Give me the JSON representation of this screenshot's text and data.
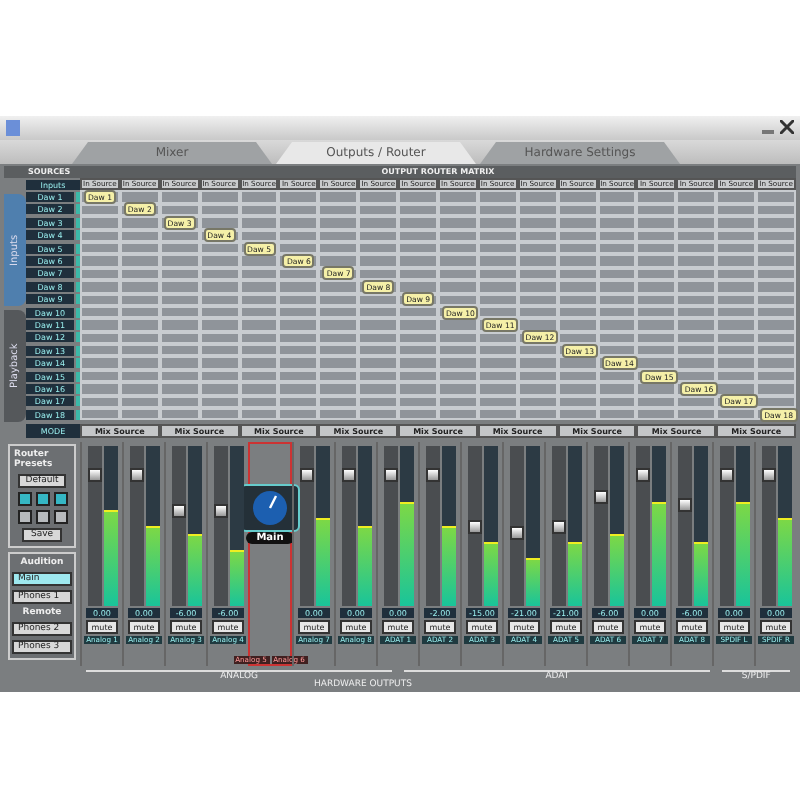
{
  "tabs": [
    {
      "label": "Mixer",
      "selected": false
    },
    {
      "label": "Outputs / Router",
      "selected": true
    },
    {
      "label": "Hardware Settings",
      "selected": false
    }
  ],
  "sources_header": "SOURCES",
  "matrix_title": "OUTPUT ROUTER MATRIX",
  "side_tabs": [
    {
      "label": "Inputs",
      "selected": true
    },
    {
      "label": "Playback",
      "selected": false
    }
  ],
  "source_header": "Inputs",
  "mode_label": "MODE",
  "matrix": {
    "columns": [
      "In Source",
      "In Source",
      "In Source",
      "In Source",
      "In Source",
      "In Source",
      "In Source",
      "In Source",
      "In Source",
      "In Source",
      "In Source",
      "In Source",
      "In Source",
      "In Source",
      "In Source",
      "In Source",
      "In Source",
      "In Source"
    ],
    "rows": [
      {
        "label": "Daw 1",
        "cells": [
          {
            "routed": true,
            "text": "Daw 1"
          },
          {
            "routed": false
          },
          {
            "routed": false
          },
          {
            "routed": false
          },
          {
            "routed": false
          },
          {
            "routed": false
          },
          {
            "routed": false
          },
          {
            "routed": false
          },
          {
            "routed": false
          },
          {
            "routed": false
          },
          {
            "routed": false
          },
          {
            "routed": false
          },
          {
            "routed": false
          },
          {
            "routed": false
          },
          {
            "routed": false
          },
          {
            "routed": false
          },
          {
            "routed": false
          },
          {
            "routed": false
          }
        ]
      },
      {
        "label": "Daw 2",
        "cells": [
          {
            "routed": false
          },
          {
            "routed": true,
            "text": "Daw 2"
          },
          {
            "routed": false
          },
          {
            "routed": false
          },
          {
            "routed": false
          },
          {
            "routed": false
          },
          {
            "routed": false
          },
          {
            "routed": false
          },
          {
            "routed": false
          },
          {
            "routed": false
          },
          {
            "routed": false
          },
          {
            "routed": false
          },
          {
            "routed": false
          },
          {
            "routed": false
          },
          {
            "routed": false
          },
          {
            "routed": false
          },
          {
            "routed": false
          },
          {
            "routed": false
          }
        ]
      },
      {
        "label": "Daw 3",
        "cells": [
          {
            "routed": false
          },
          {
            "routed": false
          },
          {
            "routed": true,
            "text": "Daw 3"
          },
          {
            "routed": false
          },
          {
            "routed": false
          },
          {
            "routed": false
          },
          {
            "routed": false
          },
          {
            "routed": false
          },
          {
            "routed": false
          },
          {
            "routed": false
          },
          {
            "routed": false
          },
          {
            "routed": false
          },
          {
            "routed": false
          },
          {
            "routed": false
          },
          {
            "routed": false
          },
          {
            "routed": false
          },
          {
            "routed": false
          },
          {
            "routed": false
          }
        ]
      },
      {
        "label": "Daw 4",
        "cells": [
          {
            "routed": false
          },
          {
            "routed": false
          },
          {
            "routed": false
          },
          {
            "routed": true,
            "text": "Daw 4"
          },
          {
            "routed": false
          },
          {
            "routed": false
          },
          {
            "routed": false
          },
          {
            "routed": false
          },
          {
            "routed": false
          },
          {
            "routed": false
          },
          {
            "routed": false
          },
          {
            "routed": false
          },
          {
            "routed": false
          },
          {
            "routed": false
          },
          {
            "routed": false
          },
          {
            "routed": false
          },
          {
            "routed": false
          },
          {
            "routed": false
          }
        ]
      },
      {
        "label": "Daw 5",
        "cells": [
          {
            "routed": false
          },
          {
            "routed": false
          },
          {
            "routed": false
          },
          {
            "routed": false
          },
          {
            "routed": true,
            "text": "Daw 5"
          },
          {
            "routed": false
          },
          {
            "routed": false
          },
          {
            "routed": false
          },
          {
            "routed": false
          },
          {
            "routed": false
          },
          {
            "routed": false
          },
          {
            "routed": false
          },
          {
            "routed": false
          },
          {
            "routed": false
          },
          {
            "routed": false
          },
          {
            "routed": false
          },
          {
            "routed": false
          },
          {
            "routed": false
          }
        ]
      },
      {
        "label": "Daw 6",
        "cells": [
          {
            "routed": false
          },
          {
            "routed": false
          },
          {
            "routed": false
          },
          {
            "routed": false
          },
          {
            "routed": false
          },
          {
            "routed": true,
            "text": "Daw 6"
          },
          {
            "routed": false
          },
          {
            "routed": false
          },
          {
            "routed": false
          },
          {
            "routed": false
          },
          {
            "routed": false
          },
          {
            "routed": false
          },
          {
            "routed": false
          },
          {
            "routed": false
          },
          {
            "routed": false
          },
          {
            "routed": false
          },
          {
            "routed": false
          },
          {
            "routed": false
          }
        ]
      },
      {
        "label": "Daw 7",
        "cells": [
          {
            "routed": false
          },
          {
            "routed": false
          },
          {
            "routed": false
          },
          {
            "routed": false
          },
          {
            "routed": false
          },
          {
            "routed": false
          },
          {
            "routed": true,
            "text": "Daw 7"
          },
          {
            "routed": false
          },
          {
            "routed": false
          },
          {
            "routed": false
          },
          {
            "routed": false
          },
          {
            "routed": false
          },
          {
            "routed": false
          },
          {
            "routed": false
          },
          {
            "routed": false
          },
          {
            "routed": false
          },
          {
            "routed": false
          },
          {
            "routed": false
          }
        ]
      },
      {
        "label": "Daw 8",
        "cells": [
          {
            "routed": false
          },
          {
            "routed": false
          },
          {
            "routed": false
          },
          {
            "routed": false
          },
          {
            "routed": false
          },
          {
            "routed": false
          },
          {
            "routed": false
          },
          {
            "routed": true,
            "text": "Daw 8"
          },
          {
            "routed": false
          },
          {
            "routed": false
          },
          {
            "routed": false
          },
          {
            "routed": false
          },
          {
            "routed": false
          },
          {
            "routed": false
          },
          {
            "routed": false
          },
          {
            "routed": false
          },
          {
            "routed": false
          },
          {
            "routed": false
          }
        ]
      },
      {
        "label": "Daw 9",
        "cells": [
          {
            "routed": false
          },
          {
            "routed": false
          },
          {
            "routed": false
          },
          {
            "routed": false
          },
          {
            "routed": false
          },
          {
            "routed": false
          },
          {
            "routed": false
          },
          {
            "routed": false
          },
          {
            "routed": true,
            "text": "Daw 9"
          },
          {
            "routed": false
          },
          {
            "routed": false
          },
          {
            "routed": false
          },
          {
            "routed": false
          },
          {
            "routed": false
          },
          {
            "routed": false
          },
          {
            "routed": false
          },
          {
            "routed": false
          },
          {
            "routed": false
          }
        ]
      },
      {
        "label": "Daw 10",
        "cells": [
          {
            "routed": false
          },
          {
            "routed": false
          },
          {
            "routed": false
          },
          {
            "routed": false
          },
          {
            "routed": false
          },
          {
            "routed": false
          },
          {
            "routed": false
          },
          {
            "routed": false
          },
          {
            "routed": false
          },
          {
            "routed": true,
            "text": "Daw 10"
          },
          {
            "routed": false
          },
          {
            "routed": false
          },
          {
            "routed": false
          },
          {
            "routed": false
          },
          {
            "routed": false
          },
          {
            "routed": false
          },
          {
            "routed": false
          },
          {
            "routed": false
          }
        ]
      },
      {
        "label": "Daw 11",
        "cells": [
          {
            "routed": false
          },
          {
            "routed": false
          },
          {
            "routed": false
          },
          {
            "routed": false
          },
          {
            "routed": false
          },
          {
            "routed": false
          },
          {
            "routed": false
          },
          {
            "routed": false
          },
          {
            "routed": false
          },
          {
            "routed": false
          },
          {
            "routed": true,
            "text": "Daw 11"
          },
          {
            "routed": false
          },
          {
            "routed": false
          },
          {
            "routed": false
          },
          {
            "routed": false
          },
          {
            "routed": false
          },
          {
            "routed": false
          },
          {
            "routed": false
          }
        ]
      },
      {
        "label": "Daw 12",
        "cells": [
          {
            "routed": false
          },
          {
            "routed": false
          },
          {
            "routed": false
          },
          {
            "routed": false
          },
          {
            "routed": false
          },
          {
            "routed": false
          },
          {
            "routed": false
          },
          {
            "routed": false
          },
          {
            "routed": false
          },
          {
            "routed": false
          },
          {
            "routed": false
          },
          {
            "routed": true,
            "text": "Daw 12"
          },
          {
            "routed": false
          },
          {
            "routed": false
          },
          {
            "routed": false
          },
          {
            "routed": false
          },
          {
            "routed": false
          },
          {
            "routed": false
          }
        ]
      },
      {
        "label": "Daw 13",
        "cells": [
          {
            "routed": false
          },
          {
            "routed": false
          },
          {
            "routed": false
          },
          {
            "routed": false
          },
          {
            "routed": false
          },
          {
            "routed": false
          },
          {
            "routed": false
          },
          {
            "routed": false
          },
          {
            "routed": false
          },
          {
            "routed": false
          },
          {
            "routed": false
          },
          {
            "routed": false
          },
          {
            "routed": true,
            "text": "Daw 13"
          },
          {
            "routed": false
          },
          {
            "routed": false
          },
          {
            "routed": false
          },
          {
            "routed": false
          },
          {
            "routed": false
          }
        ]
      },
      {
        "label": "Daw 14",
        "cells": [
          {
            "routed": false
          },
          {
            "routed": false
          },
          {
            "routed": false
          },
          {
            "routed": false
          },
          {
            "routed": false
          },
          {
            "routed": false
          },
          {
            "routed": false
          },
          {
            "routed": false
          },
          {
            "routed": false
          },
          {
            "routed": false
          },
          {
            "routed": false
          },
          {
            "routed": false
          },
          {
            "routed": false
          },
          {
            "routed": true,
            "text": "Daw 14"
          },
          {
            "routed": false
          },
          {
            "routed": false
          },
          {
            "routed": false
          },
          {
            "routed": false
          }
        ]
      },
      {
        "label": "Daw 15",
        "cells": [
          {
            "routed": false
          },
          {
            "routed": false
          },
          {
            "routed": false
          },
          {
            "routed": false
          },
          {
            "routed": false
          },
          {
            "routed": false
          },
          {
            "routed": false
          },
          {
            "routed": false
          },
          {
            "routed": false
          },
          {
            "routed": false
          },
          {
            "routed": false
          },
          {
            "routed": false
          },
          {
            "routed": false
          },
          {
            "routed": false
          },
          {
            "routed": true,
            "text": "Daw 15"
          },
          {
            "routed": false
          },
          {
            "routed": false
          },
          {
            "routed": false
          }
        ]
      },
      {
        "label": "Daw 16",
        "cells": [
          {
            "routed": false
          },
          {
            "routed": false
          },
          {
            "routed": false
          },
          {
            "routed": false
          },
          {
            "routed": false
          },
          {
            "routed": false
          },
          {
            "routed": false
          },
          {
            "routed": false
          },
          {
            "routed": false
          },
          {
            "routed": false
          },
          {
            "routed": false
          },
          {
            "routed": false
          },
          {
            "routed": false
          },
          {
            "routed": false
          },
          {
            "routed": false
          },
          {
            "routed": true,
            "text": "Daw 16"
          },
          {
            "routed": false
          },
          {
            "routed": false
          }
        ]
      },
      {
        "label": "Daw 17",
        "cells": [
          {
            "routed": false
          },
          {
            "routed": false
          },
          {
            "routed": false
          },
          {
            "routed": false
          },
          {
            "routed": false
          },
          {
            "routed": false
          },
          {
            "routed": false
          },
          {
            "routed": false
          },
          {
            "routed": false
          },
          {
            "routed": false
          },
          {
            "routed": false
          },
          {
            "routed": false
          },
          {
            "routed": false
          },
          {
            "routed": false
          },
          {
            "routed": false
          },
          {
            "routed": false
          },
          {
            "routed": true,
            "text": "Daw 17"
          },
          {
            "routed": false
          }
        ]
      },
      {
        "label": "Daw 18",
        "cells": [
          {
            "routed": false
          },
          {
            "routed": false
          },
          {
            "routed": false
          },
          {
            "routed": false
          },
          {
            "routed": false
          },
          {
            "routed": false
          },
          {
            "routed": false
          },
          {
            "routed": false
          },
          {
            "routed": false
          },
          {
            "routed": false
          },
          {
            "routed": false
          },
          {
            "routed": false
          },
          {
            "routed": false
          },
          {
            "routed": false
          },
          {
            "routed": false
          },
          {
            "routed": false
          },
          {
            "routed": false
          },
          {
            "routed": true,
            "text": "Daw 18"
          }
        ]
      }
    ],
    "mix_sources": [
      "Mix Source",
      "Mix Source",
      "Mix Source",
      "Mix Source",
      "Mix Source",
      "Mix Source",
      "Mix Source",
      "Mix Source",
      "Mix Source"
    ]
  },
  "presets": {
    "title": "Router Presets",
    "default": "Default",
    "slots": [
      {
        "lit": true
      },
      {
        "lit": true
      },
      {
        "lit": true
      },
      {
        "lit": false
      },
      {
        "lit": false
      },
      {
        "lit": false
      }
    ],
    "save": "Save"
  },
  "audition": {
    "title": "Audition",
    "main": "Main",
    "phones_1": "Phones 1",
    "remote_label": "Remote",
    "phones_2": "Phones 2",
    "phones_3": "Phones 3"
  },
  "strips": [
    {
      "kind": "fader",
      "name": "Analog 1",
      "fader": {
        "level": 0.85
      },
      "meter": {
        "level": 0.6
      },
      "readout": "0.00",
      "mute": "mute",
      "muted": false
    },
    {
      "kind": "fader",
      "name": "Analog 2",
      "fader": {
        "level": 0.85
      },
      "meter": {
        "level": 0.5
      },
      "readout": "0.00",
      "mute": "mute",
      "muted": false
    },
    {
      "kind": "fader",
      "name": "Analog 3",
      "fader": {
        "level": 0.6
      },
      "meter": {
        "level": 0.45
      },
      "readout": "-6.00",
      "mute": "mute",
      "muted": false
    },
    {
      "kind": "fader",
      "name": "Analog 4",
      "fader": {
        "level": 0.6
      },
      "meter": {
        "level": 0.35
      },
      "readout": "-6.00",
      "mute": "mute",
      "muted": false
    },
    {
      "kind": "monitor",
      "label": "Main",
      "names": [
        "Analog 5",
        "Analog 6"
      ]
    },
    {
      "kind": "fader",
      "name": "Analog 7",
      "fader": {
        "level": 0.85
      },
      "meter": {
        "level": 0.55
      },
      "readout": "0.00",
      "mute": "mute",
      "muted": false
    },
    {
      "kind": "fader",
      "name": "Analog 8",
      "fader": {
        "level": 0.85
      },
      "meter": {
        "level": 0.5
      },
      "readout": "0.00",
      "mute": "mute",
      "muted": false
    },
    {
      "kind": "fader",
      "name": "ADAT 1",
      "fader": {
        "level": 0.85
      },
      "meter": {
        "level": 0.65
      },
      "readout": "0.00",
      "mute": "mute",
      "muted": false
    },
    {
      "kind": "fader",
      "name": "ADAT 2",
      "fader": {
        "level": 0.85
      },
      "meter": {
        "level": 0.5
      },
      "readout": "-2.00",
      "mute": "mute",
      "muted": false
    },
    {
      "kind": "fader",
      "name": "ADAT 3",
      "fader": {
        "level": 0.5
      },
      "meter": {
        "level": 0.4
      },
      "readout": "-15.00",
      "mute": "mute",
      "muted": false
    },
    {
      "kind": "fader",
      "name": "ADAT 4",
      "fader": {
        "level": 0.45
      },
      "meter": {
        "level": 0.3
      },
      "readout": "-21.00",
      "mute": "mute",
      "muted": false
    },
    {
      "kind": "fader",
      "name": "ADAT 5",
      "fader": {
        "level": 0.5
      },
      "meter": {
        "level": 0.4
      },
      "readout": "-21.00",
      "mute": "mute",
      "muted": false
    },
    {
      "kind": "fader",
      "name": "ADAT 6",
      "fader": {
        "level": 0.7
      },
      "meter": {
        "level": 0.45
      },
      "readout": "-6.00",
      "mute": "mute",
      "muted": false
    },
    {
      "kind": "fader",
      "name": "ADAT 7",
      "fader": {
        "level": 0.85
      },
      "meter": {
        "level": 0.65
      },
      "readout": "0.00",
      "mute": "mute",
      "muted": false
    },
    {
      "kind": "fader",
      "name": "ADAT 8",
      "fader": {
        "level": 0.65
      },
      "meter": {
        "level": 0.4
      },
      "readout": "-6.00",
      "mute": "mute",
      "muted": false
    },
    {
      "kind": "fader",
      "name": "SPDIF L",
      "fader": {
        "level": 0.85
      },
      "meter": {
        "level": 0.65
      },
      "readout": "0.00",
      "mute": "mute",
      "muted": false
    },
    {
      "kind": "fader",
      "name": "SPDIF R",
      "fader": {
        "level": 0.85
      },
      "meter": {
        "level": 0.55
      },
      "readout": "0.00",
      "mute": "mute",
      "muted": false
    }
  ],
  "groups": [
    {
      "kind": "analog",
      "label": "ANALOG"
    },
    {
      "kind": "adat",
      "label": "ADAT"
    },
    {
      "kind": "spdif",
      "label": "S/PDIF"
    }
  ],
  "footer": "HARDWARE OUTPUTS"
}
